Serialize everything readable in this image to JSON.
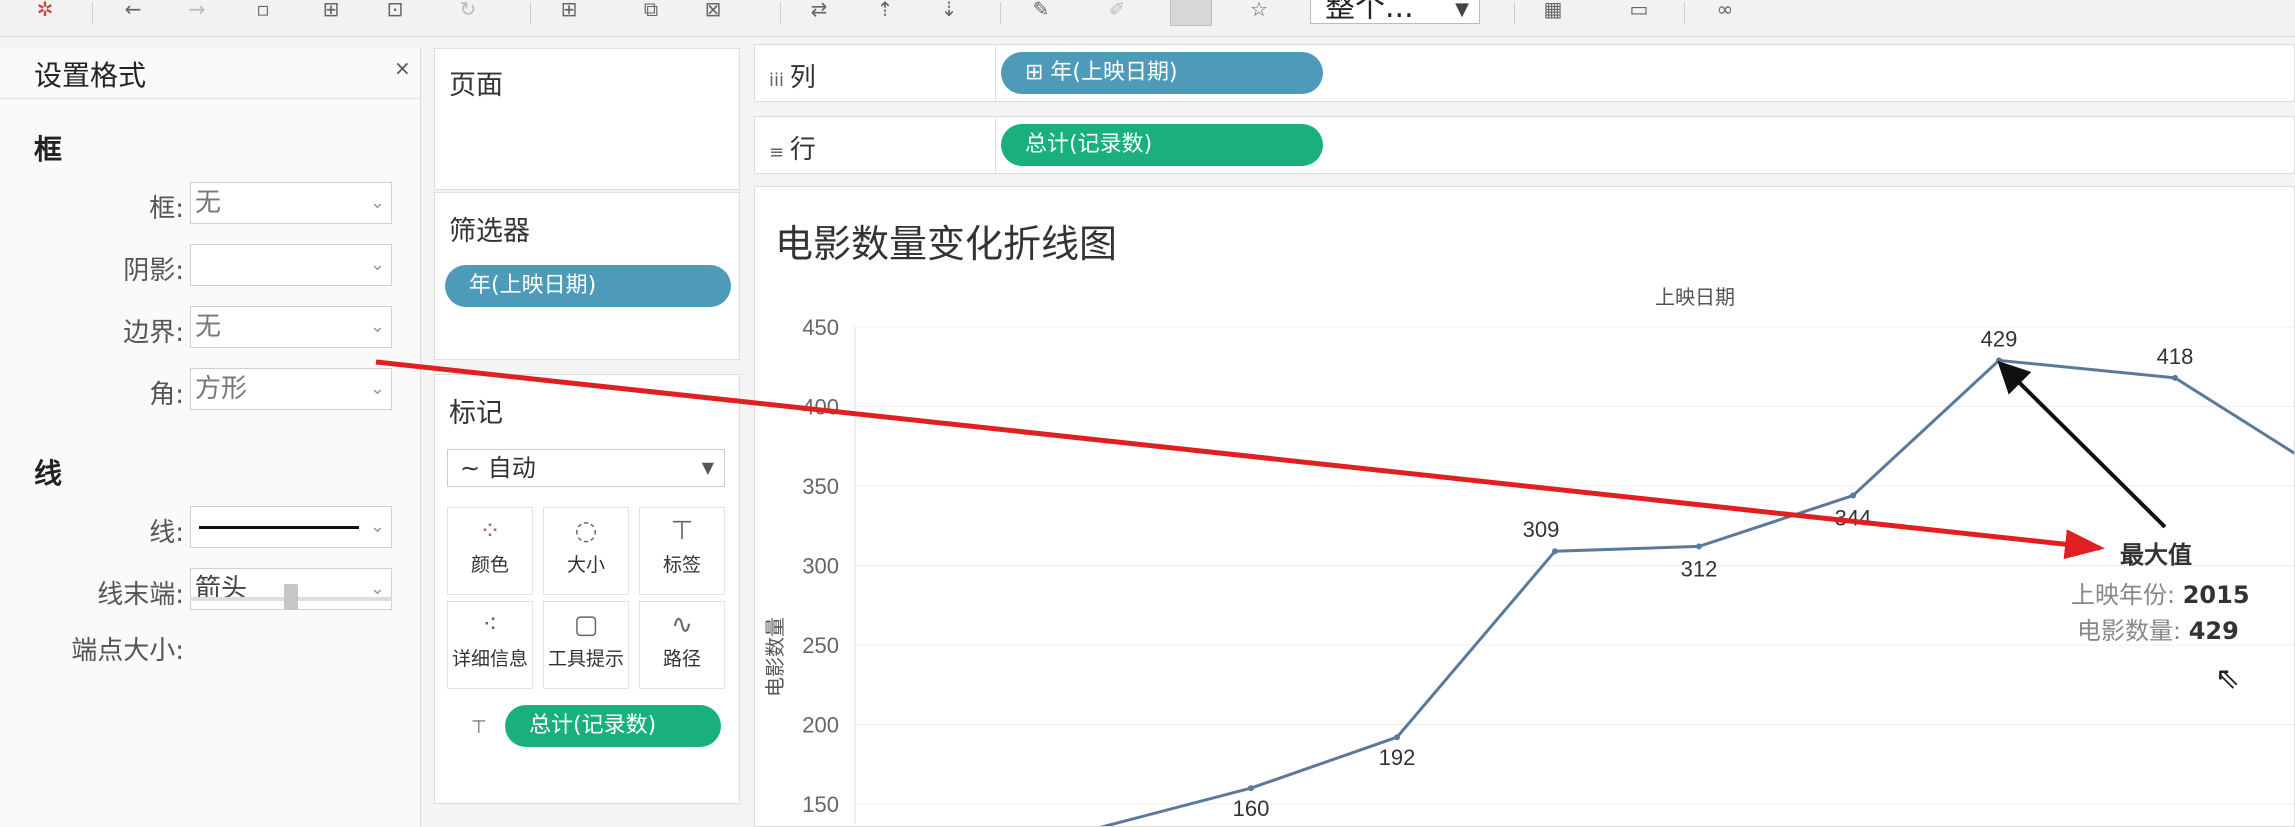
{
  "format_panel": {
    "title": "设置格式",
    "close": "×",
    "frame_section": "框",
    "frame_label": "框:",
    "frame_value": "无",
    "shadow_label": "阴影:",
    "shadow_value": "",
    "border_label": "边界:",
    "border_value": "无",
    "corner_label": "角:",
    "corner_value": "方形",
    "line_section": "线",
    "line_label": "线:",
    "line_end_label": "线末端:",
    "line_end_value": "箭头",
    "endpoint_size_label": "端点大小:"
  },
  "toolbar": {
    "fit_value": "整个..."
  },
  "pages_card": {
    "title": "页面"
  },
  "filters_card": {
    "title": "筛选器",
    "pill": "年(上映日期)"
  },
  "marks_card": {
    "title": "标记",
    "type_value": "∼ 自动",
    "buttons": [
      {
        "label": "颜色"
      },
      {
        "label": "大小"
      },
      {
        "label": "标签"
      },
      {
        "label": "详细信息"
      },
      {
        "label": "工具提示"
      },
      {
        "label": "路径"
      }
    ],
    "pill": "总计(记录数)"
  },
  "columns_shelf": {
    "label": "列",
    "pill": "⊞ 年(上映日期)"
  },
  "rows_shelf": {
    "label": "行",
    "pill": "总计(记录数)"
  },
  "colors": {
    "line": "#5b7a9b",
    "blue_pill": "#4e9bb9",
    "green_pill": "#1ab07e",
    "red_arrow": "#e02020"
  },
  "chart_data": {
    "type": "line",
    "title": "电影数量变化折线图",
    "xlabel": "上映日期",
    "ylabel": "电影数量",
    "ylim": [
      150,
      450
    ],
    "yticks": [
      450,
      400,
      350,
      300,
      250,
      200,
      150
    ],
    "points": [
      {
        "value": 160,
        "label": "160"
      },
      {
        "value": 192,
        "label": "192"
      },
      {
        "value": 309,
        "label": "309"
      },
      {
        "value": 312,
        "label": "312"
      },
      {
        "value": 344,
        "label": "344"
      },
      {
        "value": 429,
        "label": "429"
      },
      {
        "value": 418,
        "label": "418"
      }
    ],
    "annotation": {
      "title": "最大值",
      "year_label": "上映年份:",
      "year_value": "2015",
      "count_label": "电影数量:",
      "count_value": "429"
    }
  }
}
